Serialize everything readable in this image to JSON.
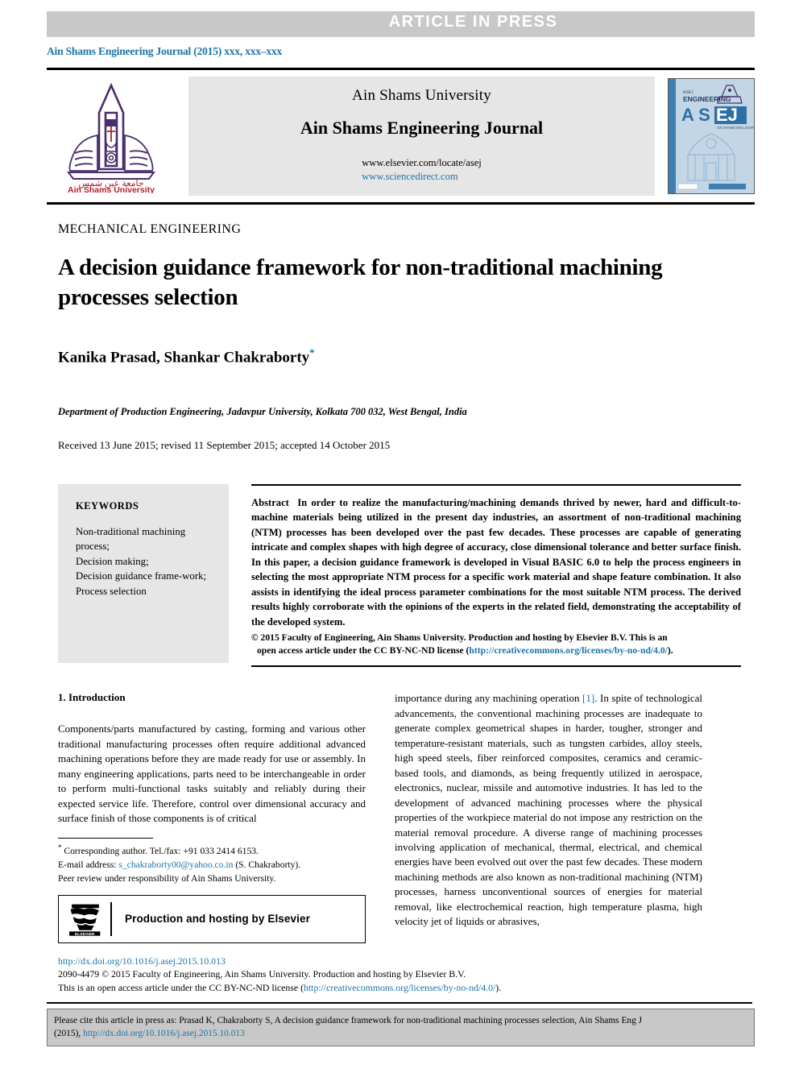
{
  "banner": {
    "text": "ARTICLE  IN  PRESS"
  },
  "journal_line": "Ain Shams Engineering Journal (2015) xxx, xxx–xxx",
  "masthead": {
    "university": "Ain Shams University",
    "journal_title": "Ain Shams Engineering Journal",
    "url_elsevier": "www.elsevier.com/locate/asej",
    "url_sciencedirect": "www.sciencedirect.com",
    "logo_caption_ar": "جامعة عين شمس",
    "logo_caption_en": "Ain Shams University",
    "cover": {
      "top_label": "ENGINEERING",
      "acronym": "ASEJ",
      "sub": "AIN SHAMS ENGINEERING JOURNAL"
    }
  },
  "article": {
    "section_label": "MECHANICAL ENGINEERING",
    "title": "A decision guidance framework for non-traditional machining processes selection",
    "authors": "Kanika Prasad, Shankar Chakraborty",
    "corresponding_marker": "*",
    "affiliation": "Department of Production Engineering, Jadavpur University, Kolkata 700 032, West Bengal, India",
    "history": "Received 13 June 2015; revised 11 September 2015; accepted 14 October 2015"
  },
  "keywords": {
    "title": "KEYWORDS",
    "items": [
      "Non-traditional machining process;",
      "Decision making;",
      "Decision guidance frame-work;",
      "Process selection"
    ]
  },
  "abstract": {
    "label": "Abstract",
    "text": "In order to realize the manufacturing/machining demands thrived by newer, hard and difficult-to-machine materials being utilized in the present day industries, an assortment of non-traditional machining (NTM) processes has been developed over the past few decades. These processes are capable of generating intricate and complex shapes with high degree of accuracy, close dimensional tolerance and better surface finish. In this paper, a decision guidance framework is developed in Visual BASIC 6.0 to help the process engineers in selecting the most appropriate NTM process for a specific work material and shape feature combination. It also assists in identifying the ideal process parameter combinations for the most suitable NTM process. The derived results highly corroborate with the opinions of the experts in the related field, demonstrating the acceptability of the developed system.",
    "copyright_line1": "© 2015 Faculty of Engineering, Ain Shams University. Production and hosting by Elsevier B.V. This is an",
    "copyright_line2_pre": "open access article under the CC BY-NC-ND license (",
    "copyright_link": "http://creativecommons.org/licenses/by-no-nd/4.0/",
    "copyright_line2_post": ")."
  },
  "body": {
    "section_heading": "1. Introduction",
    "left_paragraph": "Components/parts manufactured by casting, forming and various other traditional manufacturing processes often require additional advanced machining operations before they are made ready for use or assembly. In many engineering applications, parts need to be interchangeable in order to perform multi-functional tasks suitably and reliably during their expected service life. Therefore, control over dimensional accuracy and surface finish of those components is of critical",
    "right_paragraph_pre": "importance during any machining operation ",
    "right_citation": "[1]",
    "right_paragraph_post": ". In spite of technological advancements, the conventional machining processes are inadequate to generate complex geometrical shapes in harder, tougher, stronger and temperature-resistant materials, such as tungsten carbides, alloy steels, high speed steels, fiber reinforced composites, ceramics and ceramic-based tools, and diamonds, as being frequently utilized in aerospace, electronics, nuclear, missile and automotive industries. It has led to the development of advanced machining processes where the physical properties of the workpiece material do not impose any restriction on the material removal procedure. A diverse range of machining processes involving application of mechanical, thermal, electrical, and chemical energies have been evolved out over the past few decades. These modern machining methods are also known as non-traditional machining (NTM) processes, harness unconventional sources of energies for material removal, like electrochemical reaction, high temperature plasma, high velocity jet of liquids or abrasives,"
  },
  "footnote": {
    "corresponding": "Corresponding author. Tel./fax: +91 033 2414 6153.",
    "email_label": "E-mail address:",
    "email": "s_chakraborty00@yahoo.co.in",
    "email_suffix": "(S. Chakraborty).",
    "peer_review": "Peer review under responsibility of Ain Shams University."
  },
  "elsevier_box": {
    "text": "Production and hosting by Elsevier",
    "logo_word": "ELSEVIER"
  },
  "legal": {
    "doi": "http://dx.doi.org/10.1016/j.asej.2015.10.013",
    "line2": "2090-4479 © 2015 Faculty of Engineering, Ain Shams University. Production and hosting by Elsevier B.V.",
    "line3_pre": "This is an open access article under the CC BY-NC-ND license (",
    "line3_link": "http://creativecommons.org/licenses/by-no-nd/4.0/",
    "line3_post": ")."
  },
  "cite_box": {
    "line1": "Please cite this article in press as: Prasad K, Chakraborty S, A decision guidance framework for non-traditional machining processes selection, Ain Shams Eng J",
    "line2_pre": "(2015), ",
    "line2_link": "http://dx.doi.org/10.1016/j.asej.2015.10.013"
  },
  "colors": {
    "accent_link": "#1b74a8",
    "banner_bg": "#c8c8c8",
    "panel_bg": "#e6e6e6",
    "logo_purple": "#4a2d6b",
    "logo_red": "#b5202a"
  }
}
